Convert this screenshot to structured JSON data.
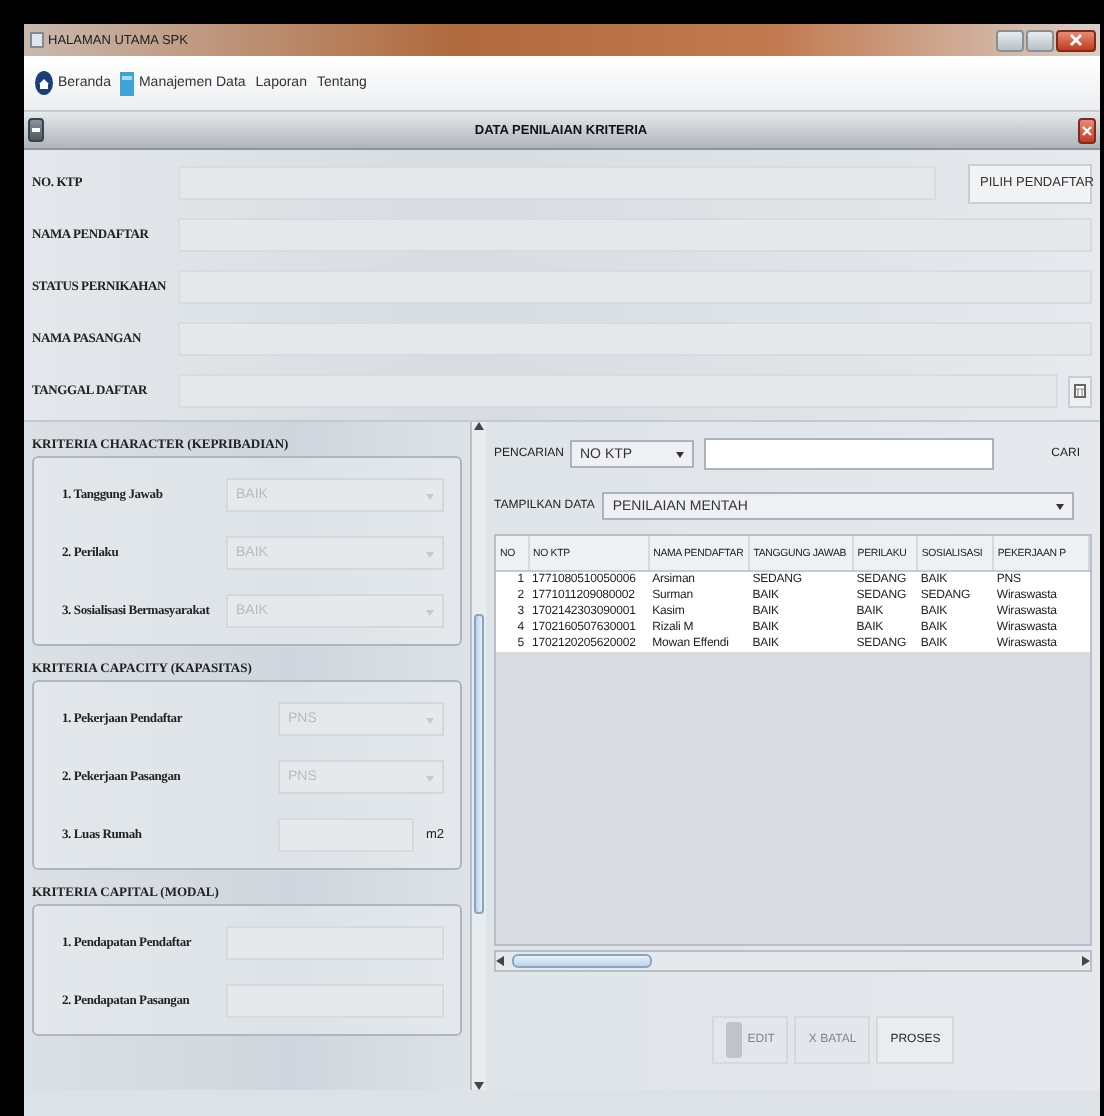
{
  "window": {
    "title": "HALAMAN UTAMA SPK"
  },
  "menu": [
    {
      "label": "Beranda"
    },
    {
      "label": "Manajemen Data"
    },
    {
      "label": "Laporan"
    },
    {
      "label": "Tentang"
    }
  ],
  "frame": {
    "title": "DATA PENILAIAN KRITERIA"
  },
  "form": {
    "fields": [
      {
        "label": "NO. KTP",
        "kind": "lookup"
      },
      {
        "label": "NAMA PENDAFTAR",
        "kind": "text"
      },
      {
        "label": "STATUS PERNIKAHAN",
        "kind": "text"
      },
      {
        "label": "NAMA PASANGAN",
        "kind": "text"
      },
      {
        "label": "TANGGAL DAFTAR",
        "kind": "date"
      }
    ],
    "pick_button": "PILIH PENDAFTAR"
  },
  "sections": [
    {
      "title": "KRITERIA CHARACTER (KEPRIBADIAN)",
      "items": [
        {
          "label": "1. Tanggung Jawab",
          "kind": "select",
          "value": "BAIK"
        },
        {
          "label": "2. Perilaku",
          "kind": "select",
          "value": "BAIK"
        },
        {
          "label": "3. Sosialisasi Bermasyarakat",
          "kind": "select",
          "value": "BAIK"
        }
      ]
    },
    {
      "title": "KRITERIA CAPACITY (KAPASITAS)",
      "items": [
        {
          "label": "1. Pekerjaan Pendaftar",
          "kind": "select",
          "value": "PNS"
        },
        {
          "label": "2. Pekerjaan Pasangan",
          "kind": "select",
          "value": "PNS"
        },
        {
          "label": "3. Luas Rumah",
          "kind": "input",
          "unit": "m2"
        }
      ]
    },
    {
      "title": "KRITERIA CAPITAL (MODAL)",
      "items": [
        {
          "label": "1. Pendapatan Pendaftar",
          "kind": "input"
        },
        {
          "label": "2. Pendapatan Pasangan",
          "kind": "input"
        }
      ]
    }
  ],
  "search": {
    "label": "PENCARIAN",
    "field": "NO KTP",
    "button": "CARI"
  },
  "display": {
    "label": "TAMPILKAN DATA",
    "value": "PENILAIAN MENTAH"
  },
  "table": {
    "columns": [
      "NO",
      "NO KTP",
      "NAMA PENDAFTAR",
      "TANGGUNG JAWAB",
      "PERILAKU",
      "SOSIALISASI",
      "PEKERJAAN P"
    ],
    "rows": [
      [
        "1",
        "1771080510050006",
        "Arsiman",
        "SEDANG",
        "SEDANG",
        "BAIK",
        "PNS"
      ],
      [
        "2",
        "1771011209080002",
        "Surman",
        "BAIK",
        "SEDANG",
        "SEDANG",
        "Wiraswasta"
      ],
      [
        "3",
        "1702142303090001",
        "Kasim",
        "BAIK",
        "BAIK",
        "BAIK",
        "Wiraswasta"
      ],
      [
        "4",
        "1702160507630001",
        "Rizali M",
        "BAIK",
        "BAIK",
        "BAIK",
        "Wiraswasta"
      ],
      [
        "5",
        "1702120205620002",
        "Mowan Effendi",
        "BAIK",
        "SEDANG",
        "BAIK",
        "Wiraswasta"
      ]
    ]
  },
  "buttons": [
    {
      "label": "EDIT",
      "disabled": true
    },
    {
      "label": "X BATAL",
      "disabled": true
    },
    {
      "label": "PROSES",
      "disabled": false
    }
  ]
}
